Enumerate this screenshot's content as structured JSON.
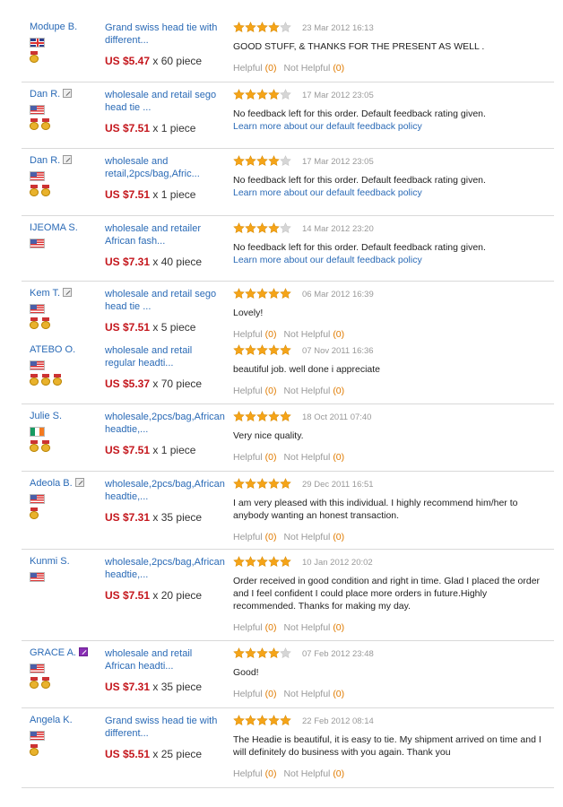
{
  "labels": {
    "helpful": "Helpful",
    "not_helpful": "Not Helpful",
    "price_separator": "x",
    "price_unit": "piece"
  },
  "colors": {
    "link": "#2a6ab6",
    "price": "#c4161c",
    "star": "#f5a418",
    "count": "#e07b00"
  },
  "reviews": [
    {
      "name": "Modupe B.",
      "edited": false,
      "flag": "uk",
      "medals": 1,
      "product": [
        "Grand swiss head tie with",
        "different..."
      ],
      "price": "US $5.47",
      "qty": "60",
      "rating": 4,
      "date": "23 Mar 2012 16:13",
      "message": [
        "GOOD STUFF, & THANKS FOR THE PRESENT AS WELL ."
      ],
      "policy": "",
      "helpful": "(0)",
      "not_helpful": "(0)"
    },
    {
      "name": "Dan R.",
      "edited": true,
      "flag": "us",
      "medals": 2,
      "product": [
        "wholesale and retail sego",
        "head tie ..."
      ],
      "price": "US $7.51",
      "qty": "1",
      "rating": 4,
      "date": "17 Mar 2012 23:05",
      "message": [
        "No feedback left for this order. Default feedback rating given."
      ],
      "policy": "Learn more about our default feedback policy",
      "helpful": "",
      "not_helpful": ""
    },
    {
      "name": "Dan R.",
      "edited": true,
      "flag": "us",
      "medals": 2,
      "product": [
        "wholesale and",
        "retail,2pcs/bag,Afric..."
      ],
      "price": "US $7.51",
      "qty": "1",
      "rating": 4,
      "date": "17 Mar 2012 23:05",
      "message": [
        "No feedback left for this order. Default feedback rating given."
      ],
      "policy": "Learn more about our default feedback policy",
      "helpful": "",
      "not_helpful": ""
    },
    {
      "name": "IJEOMA S.",
      "edited": false,
      "flag": "us",
      "medals": 0,
      "product": [
        "wholesale and retailer",
        "African fash..."
      ],
      "price": "US $7.31",
      "qty": "40",
      "rating": 4,
      "date": "14 Mar 2012 23:20",
      "message": [
        "No feedback left for this order. Default feedback rating given."
      ],
      "policy": "Learn more about our default feedback policy",
      "helpful": "",
      "not_helpful": ""
    },
    {
      "name": "Kem T.",
      "edited": true,
      "flag": "us",
      "medals": 2,
      "product": [
        "wholesale and retail sego",
        "head tie ..."
      ],
      "price": "US $7.51",
      "qty": "5",
      "rating": 5,
      "date": "06 Mar 2012 16:39",
      "message": [
        "Lovely!"
      ],
      "policy": "",
      "helpful": "(0)",
      "not_helpful": "(0)"
    },
    {
      "name": "ATEBO O.",
      "edited": false,
      "flag": "us",
      "medals": 3,
      "product": [
        "wholesale and retail",
        "regular headti..."
      ],
      "price": "US $5.37",
      "qty": "70",
      "rating": 5,
      "date": "07 Nov 2011 16:36",
      "message": [
        "beautiful job. well done i appreciate"
      ],
      "policy": "",
      "helpful": "(0)",
      "not_helpful": "(0)"
    },
    {
      "name": "Julie S.",
      "edited": false,
      "flag": "ie",
      "medals": 2,
      "product": [
        "wholesale,2pcs/bag,African",
        "headtie,..."
      ],
      "price": "US $7.51",
      "qty": "1",
      "rating": 5,
      "date": "18 Oct 2011 07:40",
      "message": [
        "Very nice quality."
      ],
      "policy": "",
      "helpful": "(0)",
      "not_helpful": "(0)"
    },
    {
      "name": "Adeola B.",
      "edited": true,
      "flag": "us",
      "medals": 1,
      "product": [
        "wholesale,2pcs/bag,African",
        "headtie,..."
      ],
      "price": "US $7.31",
      "qty": "35",
      "rating": 5,
      "date": "29 Dec 2011 16:51",
      "message": [
        "I am very pleased with this individual. I highly recommend him/her to",
        "anybody wanting an honest transaction."
      ],
      "policy": "",
      "helpful": "(0)",
      "not_helpful": "(0)"
    },
    {
      "name": "Kunmi S.",
      "edited": false,
      "flag": "us",
      "medals": 0,
      "product": [
        "wholesale,2pcs/bag,African",
        "headtie,..."
      ],
      "price": "US $7.51",
      "qty": "20",
      "rating": 5,
      "date": "10 Jan 2012 20:02",
      "message": [
        "Order received in good condition and right in time. Glad I placed the order",
        "and I feel confident I could place more orders in future.Highly",
        "recommended. Thanks for making my day."
      ],
      "policy": "",
      "helpful": "(0)",
      "not_helpful": "(0)"
    },
    {
      "name": "GRACE A.",
      "edited": true,
      "edited_style": "purple",
      "flag": "us",
      "medals": 2,
      "product": [
        "wholesale and retail",
        "African headti..."
      ],
      "price": "US $7.31",
      "qty": "35",
      "rating": 4,
      "date": "07 Feb 2012 23:48",
      "message": [
        "Good!"
      ],
      "policy": "",
      "helpful": "(0)",
      "not_helpful": "(0)"
    },
    {
      "name": "Angela K.",
      "edited": false,
      "flag": "us",
      "medals": 1,
      "product": [
        "Grand swiss head tie with",
        "different..."
      ],
      "price": "US $5.51",
      "qty": "25",
      "rating": 5,
      "date": "22 Feb 2012 08:14",
      "message": [
        "The Headie is beautiful, it is easy to tie. My shipment arrived on time and I",
        "will definitely do business with you again. Thank you"
      ],
      "policy": "",
      "helpful": "(0)",
      "not_helpful": "(0)"
    }
  ]
}
